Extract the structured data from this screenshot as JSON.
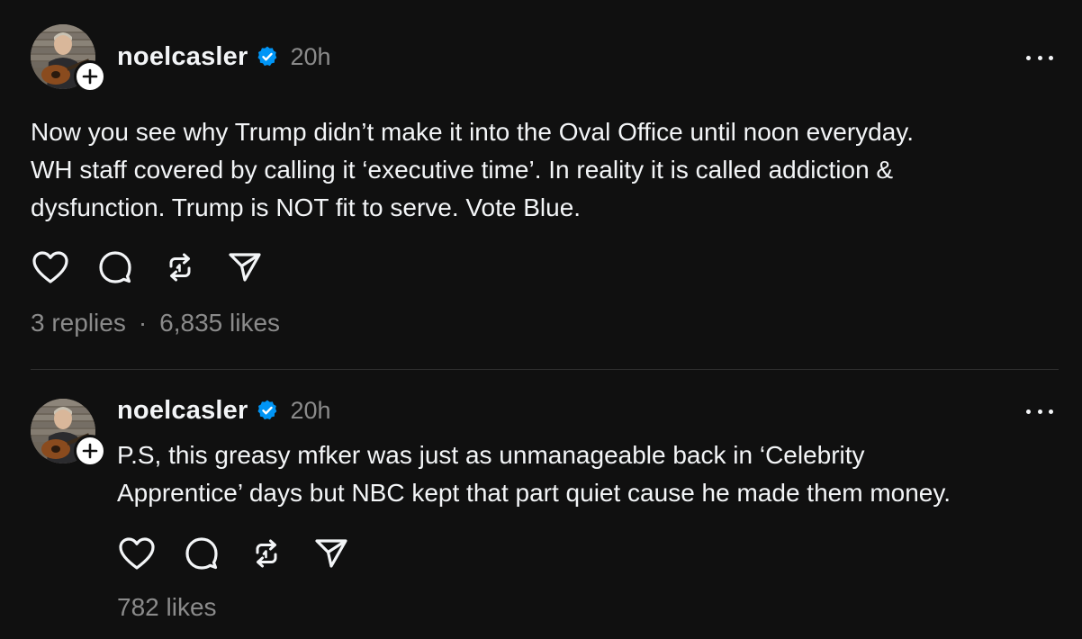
{
  "posts": [
    {
      "username": "noelcasler",
      "timestamp": "20h",
      "text_lines": [
        "Now you see why Trump didn’t make it into the Oval Office until noon everyday.",
        "WH staff covered by calling it ‘executive time’. In reality it is called addiction &",
        "dysfunction. Trump is NOT fit to serve. Vote Blue."
      ],
      "replies": "3 replies",
      "separator": "·",
      "likes": "6,835 likes"
    },
    {
      "username": "noelcasler",
      "timestamp": "20h",
      "text_lines": [
        "P.S, this greasy mfker was just as unmanageable back in ‘Celebrity",
        "Apprentice’ days but NBC kept that part quiet cause he made them money."
      ],
      "likes": "782 likes"
    }
  ],
  "icons": {
    "like": "heart-icon",
    "reply": "speech-bubble-icon",
    "repost": "repost-arrows-icon",
    "share": "paper-plane-icon",
    "verified": "verified-badge-icon",
    "follow": "plus-icon",
    "more": "ellipsis-icon"
  },
  "colors": {
    "background": "#101010",
    "text": "#f3f5f7",
    "secondary_text": "#8b8b8b",
    "verified": "#0095f6",
    "divider": "#2f2f2f"
  }
}
